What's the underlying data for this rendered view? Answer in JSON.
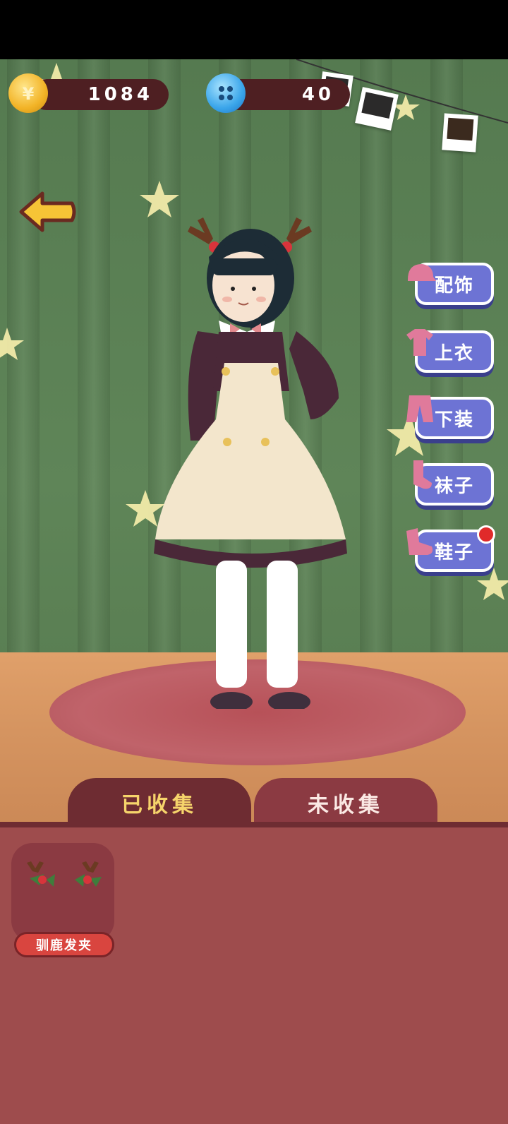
{
  "currency": {
    "coins": "1084",
    "buttons": "40"
  },
  "categories": [
    {
      "label": "配饰",
      "icon": "hat-icon"
    },
    {
      "label": "上衣",
      "icon": "shirt-icon"
    },
    {
      "label": "下装",
      "icon": "pants-icon"
    },
    {
      "label": "袜子",
      "icon": "sock-icon"
    },
    {
      "label": "鞋子",
      "icon": "shoe-icon",
      "has_notification": true
    }
  ],
  "tabs": [
    {
      "label": "已收集",
      "active": true
    },
    {
      "label": "未收集",
      "active": false
    }
  ],
  "collection": [
    {
      "label": "驯鹿发夹",
      "icon": "reindeer-hairclip-icon"
    }
  ],
  "colors": {
    "curtain": "#5f8558",
    "panel": "#9e4c4d",
    "active_tab_text": "#f6d46b",
    "category_button": "#6d73d4",
    "notification_dot": "#e02a2a"
  }
}
